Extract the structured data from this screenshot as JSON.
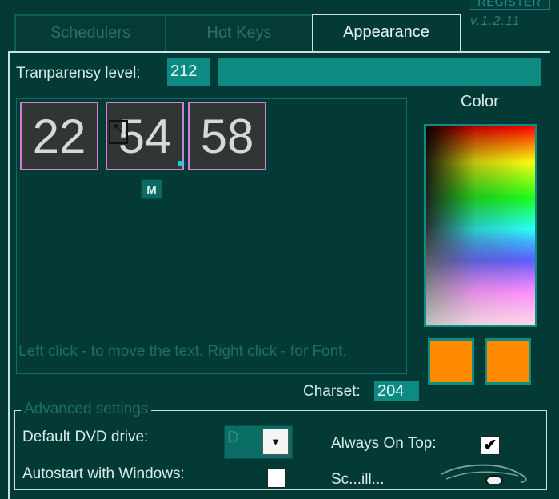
{
  "header": {
    "register_label": "REGISTER",
    "version": "v.1.2.11"
  },
  "tabs": [
    {
      "label": "Schedulers",
      "active": false
    },
    {
      "label": "Hot Keys",
      "active": false
    },
    {
      "label": "Appearance",
      "active": true
    }
  ],
  "appearance": {
    "transparency_label": "Tranparensy level:",
    "transparency_value": "212",
    "transparency_bar_fraction": 1.0,
    "clock": {
      "hours": "22",
      "minutes": "54",
      "seconds": "58"
    },
    "cursor_glyph": "↖",
    "m_button_label": "M",
    "preview_hint": "Left click - to move the text. Right click - for Font.",
    "color_label": "Color",
    "swatch_1_color": "#ff8a00",
    "swatch_2_color": "#ff8a00",
    "charset_label": "Charset:",
    "charset_value": "204"
  },
  "advanced": {
    "legend": "Advanced settings",
    "dvd_label": "Default DVD drive:",
    "dvd_value": "D",
    "autostart_label": "Autostart with Windows:",
    "always_on_top_label": "Always On Top:",
    "always_on_top_checked": true,
    "partial_label": "Sc...ill..."
  },
  "colors": {
    "background": "#033a36",
    "accent_teal": "#0d8b82",
    "digit_border": "#d47cd6"
  }
}
